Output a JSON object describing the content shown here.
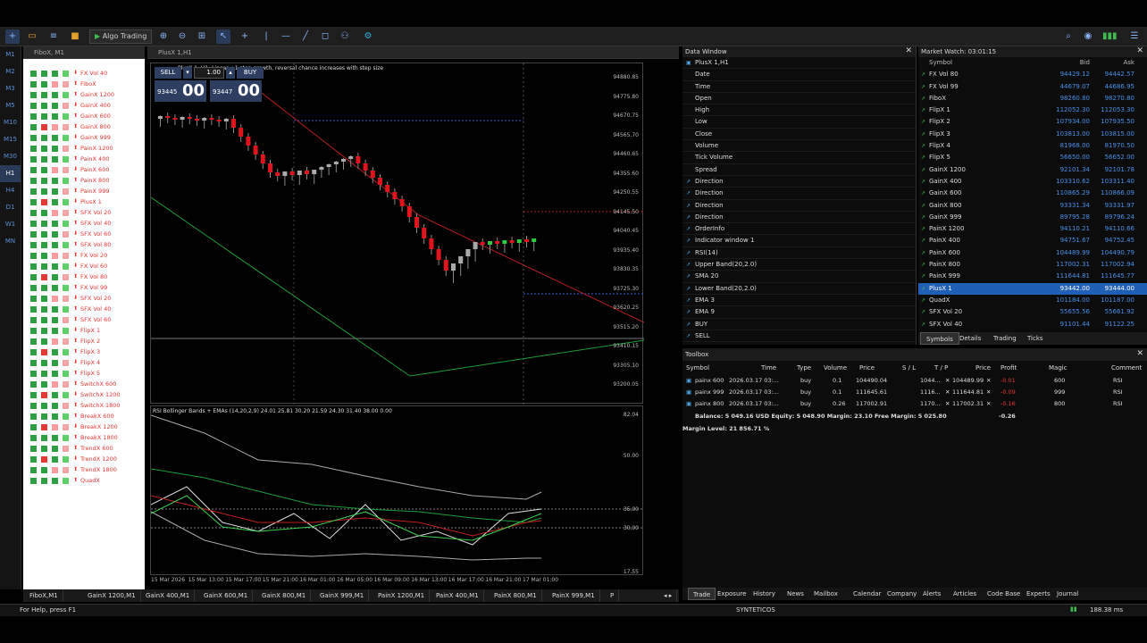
{
  "app": {
    "title": "Algo Trading"
  },
  "toolbar": {
    "algo_label": "Algo Trading"
  },
  "timeframes": [
    "M1",
    "M2",
    "M3",
    "M5",
    "M10",
    "M15",
    "M30",
    "H1",
    "H4",
    "D1",
    "W1",
    "MN"
  ],
  "active_timeframe": "H1",
  "assets_window": {
    "title": "FiboX, M1",
    "items": [
      "FX Vol 40",
      "FiboX",
      "GainX 1200",
      "GainX 400",
      "GainX 600",
      "GainX 800",
      "GainX 999",
      "PainX 1200",
      "PainX 400",
      "PainX 600",
      "PainX 800",
      "PainX 999",
      "PlusX 1",
      "SFX Vol 20",
      "SFX Vol 40",
      "SFX Vol 60",
      "SFX Vol 80",
      "FX Vol 20",
      "FX Vol 60",
      "FX Vol 80",
      "FX Vol 99",
      "SFX Vol 20",
      "SFX Vol 40",
      "SFX Vol 60",
      "FlipX 1",
      "FlipX 2",
      "FlipX 3",
      "FlipX 4",
      "FlipX 5",
      "SwitchX 600",
      "SwitchX 1200",
      "SwitchX 1800",
      "BreakX 600",
      "BreakX 1200",
      "BreakX 1800",
      "TrendX 600",
      "TrendX 1200",
      "TrendX 1800",
      "QuadX"
    ]
  },
  "chart_window": {
    "title": "PlusX 1,H1",
    "header": "PlusX 1, H1: Linear +1 step growth, reversal chance increases with step size",
    "sell_label": "SELL",
    "buy_label": "BUY",
    "lot": "1.00",
    "sell_small": "93445",
    "sell_big": "00",
    "buy_small": "93447",
    "buy_big": "00",
    "price_axis": [
      "94880.85",
      "94775.80",
      "94670.75",
      "94565.70",
      "94460.65",
      "94355.60",
      "94250.55",
      "94145.50",
      "94040.45",
      "93935.40",
      "93830.35",
      "93725.30",
      "93620.25",
      "93515.20",
      "93410.15",
      "93305.10",
      "93200.05"
    ],
    "rsi_header": "RSI Bollinger Bands + EMAs (14,20,2,9) 24.01 25.81 30.20 21.59 24.30 31.40 38.00 0.00",
    "rsi_axis": [
      "82.04",
      "50.00",
      "35.00",
      "30.00",
      "17.55"
    ],
    "time_axis": [
      "15 Mar 2026",
      "15 Mar 13:00",
      "15 Mar 17:00",
      "15 Mar 21:00",
      "16 Mar 01:00",
      "16 Mar 05:00",
      "16 Mar 09:00",
      "16 Mar 13:00",
      "16 Mar 17:00",
      "16 Mar 21:00",
      "17 Mar 01:00"
    ]
  },
  "chart_tabs": [
    "FiboX,M1",
    "GainX 1200,M1",
    "GainX 400,M1",
    "GainX 600,M1",
    "GainX 800,M1",
    "GainX 999,M1",
    "PainX 1200,M1",
    "PainX 400,M1",
    "PainX 800,M1",
    "PainX 999,M1",
    "P"
  ],
  "data_window": {
    "title": "Data Window",
    "symbol": "PlusX 1,H1",
    "rows": [
      "Date",
      "Time",
      "Open",
      "High",
      "Low",
      "Close",
      "Volume",
      "Tick Volume",
      "Spread",
      "Direction",
      "Direction",
      "Direction",
      "Direction",
      "OrderInfo",
      "Indicator window 1",
      "RSI(14)",
      "Upper Band(20,2.0)",
      "SMA 20",
      "Lower Band(20,2.0)",
      "EMA 3",
      "EMA 9",
      "BUY",
      "SELL"
    ]
  },
  "market_watch": {
    "title": "Market Watch: 03:01:15",
    "col_symbol": "Symbol",
    "col_bid": "Bid",
    "col_ask": "Ask",
    "rows": [
      {
        "s": "FX Vol 80",
        "b": "94429.12",
        "a": "94442.57"
      },
      {
        "s": "FX Vol 99",
        "b": "44679.07",
        "a": "44686.95"
      },
      {
        "s": "FiboX",
        "b": "98260.80",
        "a": "98270.80"
      },
      {
        "s": "FlipX 1",
        "b": "112052.30",
        "a": "112053.30"
      },
      {
        "s": "FlipX 2",
        "b": "107934.00",
        "a": "107935.50"
      },
      {
        "s": "FlipX 3",
        "b": "103813.00",
        "a": "103815.00"
      },
      {
        "s": "FlipX 4",
        "b": "81968.00",
        "a": "81970.50"
      },
      {
        "s": "FlipX 5",
        "b": "56650.00",
        "a": "56652.00"
      },
      {
        "s": "GainX 1200",
        "b": "92101.34",
        "a": "92101.78"
      },
      {
        "s": "GainX 400",
        "b": "103310.62",
        "a": "103311.40"
      },
      {
        "s": "GainX 600",
        "b": "110865.29",
        "a": "110866.09"
      },
      {
        "s": "GainX 800",
        "b": "93331.34",
        "a": "93331.97"
      },
      {
        "s": "GainX 999",
        "b": "89795.28",
        "a": "89796.24"
      },
      {
        "s": "PainX 1200",
        "b": "94110.21",
        "a": "94110.66"
      },
      {
        "s": "PainX 400",
        "b": "94751.67",
        "a": "94752.45"
      },
      {
        "s": "PainX 600",
        "b": "104489.99",
        "a": "104490.79"
      },
      {
        "s": "PainX 800",
        "b": "117002.31",
        "a": "117002.94"
      },
      {
        "s": "PainX 999",
        "b": "111644.81",
        "a": "111645.77"
      },
      {
        "s": "PlusX 1",
        "b": "93442.00",
        "a": "93444.00"
      },
      {
        "s": "QuadX",
        "b": "101184.00",
        "a": "101187.00"
      },
      {
        "s": "SFX Vol 20",
        "b": "55655.56",
        "a": "55661.92"
      },
      {
        "s": "SFX Vol 40",
        "b": "91101.44",
        "a": "91122.25"
      }
    ],
    "selected_index": 18,
    "tabs": [
      "Symbols",
      "Details",
      "Trading",
      "Ticks"
    ]
  },
  "toolbox": {
    "title": "Toolbox",
    "headers": [
      "Symbol",
      "Time",
      "Type",
      "Volume",
      "Price",
      "S / L",
      "T / P",
      "Price",
      "Profit",
      "Magic",
      "Comment"
    ],
    "positions": [
      {
        "symbol": "painx 600",
        "time": "2026.03.17 03:...",
        "type": "buy",
        "volume": "0.1",
        "price": "104490.04",
        "sl": "",
        "tp": "1044...",
        "cur": "104489.99",
        "profit": "-0.01",
        "magic": "600",
        "comment": "RSI"
      },
      {
        "symbol": "painx 999",
        "time": "2026.03.17 03:...",
        "type": "buy",
        "volume": "0.1",
        "price": "111645.61",
        "sl": "",
        "tp": "1116...",
        "cur": "111644.81",
        "profit": "-0.09",
        "magic": "999",
        "comment": "RSI"
      },
      {
        "symbol": "painx 800",
        "time": "2026.03.17 03:...",
        "type": "buy",
        "volume": "0.26",
        "price": "117002.91",
        "sl": "",
        "tp": "1170...",
        "cur": "117002.31",
        "profit": "-0.16",
        "magic": "800",
        "comment": "RSI"
      }
    ],
    "balance_line": "Balance: 5 049.16 USD  Equity: 5 048.90  Margin: 23.10  Free Margin: 5 025.80",
    "total_profit": "-0.26",
    "margin_level": "Margin Level: 21 856.71 %",
    "tabs": [
      "Trade",
      "Exposure",
      "History",
      "News",
      "Mailbox",
      "Calendar",
      "Company",
      "Alerts",
      "Articles",
      "Code Base",
      "Experts",
      "Journal"
    ]
  },
  "status": {
    "help": "For Help, press F1",
    "server": "SYNTETICOS",
    "ping": "188.38 ms"
  }
}
